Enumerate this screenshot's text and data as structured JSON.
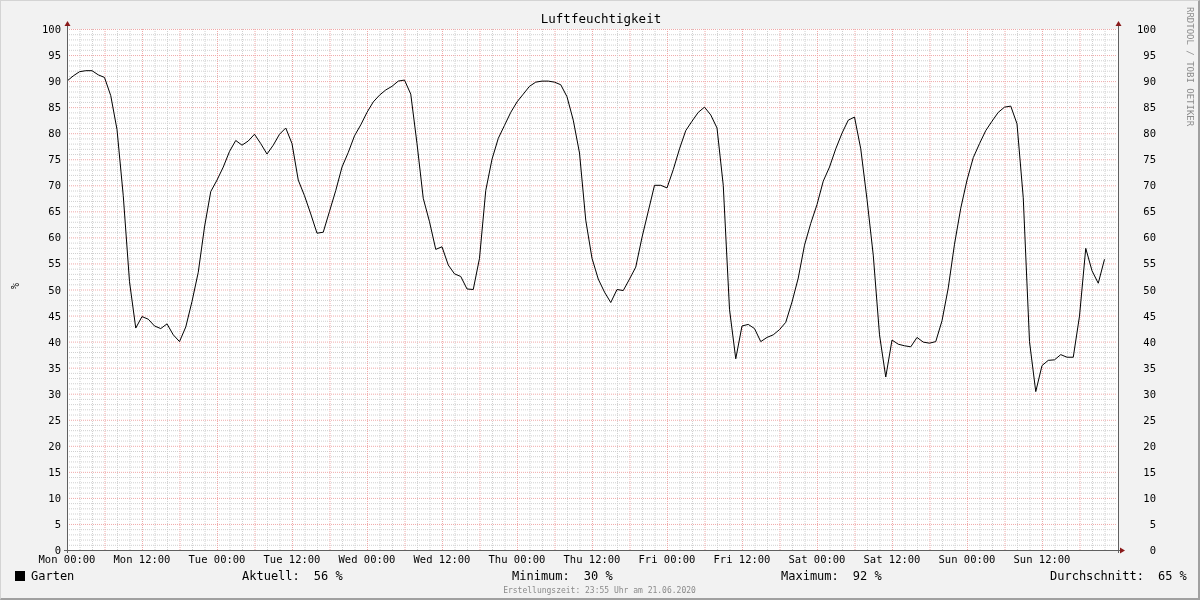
{
  "graph": {
    "left_axis_unit": "%",
    "brand": "RRDTOOL / TOBI OETIKER",
    "right_axis_labels": [
      "100",
      "95",
      "90",
      "85",
      "80",
      "75",
      "70",
      "65",
      "60",
      "55",
      "50",
      "45",
      "40",
      "35",
      "30",
      "25",
      "20",
      "15",
      "10",
      "5",
      "0"
    ],
    "chart_data": {
      "type": "line",
      "title": "Luftfeuchtigkeit",
      "ylim": [
        0,
        100
      ],
      "grid": true,
      "yticks": [
        0,
        5,
        10,
        15,
        20,
        25,
        30,
        35,
        40,
        45,
        50,
        55,
        60,
        65,
        70,
        75,
        80,
        85,
        90,
        95,
        100
      ],
      "categories": [
        "Mon 00:00",
        null,
        null,
        null,
        null,
        null,
        null,
        null,
        null,
        null,
        null,
        null,
        "Mon 12:00",
        null,
        null,
        null,
        null,
        null,
        null,
        null,
        null,
        null,
        null,
        null,
        "Tue 00:00",
        null,
        null,
        null,
        null,
        null,
        null,
        null,
        null,
        null,
        null,
        null,
        "Tue 12:00",
        null,
        null,
        null,
        null,
        null,
        null,
        null,
        null,
        null,
        null,
        null,
        "Wed 00:00",
        null,
        null,
        null,
        null,
        null,
        null,
        null,
        null,
        null,
        null,
        null,
        "Wed 12:00",
        null,
        null,
        null,
        null,
        null,
        null,
        null,
        null,
        null,
        null,
        null,
        "Thu 00:00",
        null,
        null,
        null,
        null,
        null,
        null,
        null,
        null,
        null,
        null,
        null,
        "Thu 12:00",
        null,
        null,
        null,
        null,
        null,
        null,
        null,
        null,
        null,
        null,
        null,
        "Fri 00:00",
        null,
        null,
        null,
        null,
        null,
        null,
        null,
        null,
        null,
        null,
        null,
        "Fri 12:00",
        null,
        null,
        null,
        null,
        null,
        null,
        null,
        null,
        null,
        null,
        null,
        "Sat 00:00",
        null,
        null,
        null,
        null,
        null,
        null,
        null,
        null,
        null,
        null,
        null,
        "Sat 12:00",
        null,
        null,
        null,
        null,
        null,
        null,
        null,
        null,
        null,
        null,
        null,
        "Sun 00:00",
        null,
        null,
        null,
        null,
        null,
        null,
        null,
        null,
        null,
        null,
        null,
        "Sun 12:00",
        null,
        null,
        null,
        null,
        null,
        null,
        null,
        null,
        null,
        null
      ],
      "series": [
        {
          "name": "Garten",
          "color": "#000000",
          "values": [
            90,
            91,
            91.8,
            92,
            92,
            91.2,
            90.7,
            87.2,
            80.7,
            68,
            51.5,
            42.6,
            44.8,
            44.3,
            43,
            42.5,
            43.4,
            41.3,
            40,
            42.8,
            47.7,
            53.3,
            62,
            68.8,
            71,
            73.5,
            76.5,
            78.6,
            77.7,
            78.5,
            79.8,
            78,
            76,
            77.7,
            79.8,
            81,
            78,
            71,
            68,
            64.5,
            60.8,
            61,
            65,
            69,
            73.5,
            76.3,
            79.5,
            81.6,
            84,
            86,
            87.3,
            88.3,
            89,
            90,
            90.2,
            87.5,
            78,
            67.5,
            63,
            57.7,
            58.2,
            54.7,
            53,
            52.5,
            50.1,
            50,
            56,
            69,
            75,
            79,
            81.5,
            84,
            86,
            87.5,
            89,
            89.8,
            90,
            90,
            89.8,
            89.3,
            87,
            82.5,
            76.2,
            63.3,
            56,
            52,
            49.5,
            47.5,
            50,
            49.8,
            52,
            54.3,
            60,
            65,
            70,
            70,
            69.5,
            73,
            77,
            80.5,
            82.3,
            84,
            85,
            83.5,
            81,
            70,
            46.2,
            36.7,
            43,
            43.3,
            42.5,
            40,
            40.8,
            41.3,
            42.3,
            43.7,
            47.6,
            52.2,
            58.5,
            62.7,
            66.3,
            70.8,
            73.5,
            77,
            80,
            82.5,
            83.1,
            77,
            67.3,
            56.6,
            41.3,
            33.2,
            40.3,
            39.5,
            39.2,
            39,
            40.8,
            39.9,
            39.7,
            40,
            44,
            50.3,
            58.7,
            65.6,
            71,
            75.3,
            78,
            80.5,
            82.3,
            84,
            85,
            85.2,
            81.8,
            67.6,
            40,
            30.4,
            35.4,
            36.4,
            36.5,
            37.5,
            37,
            37,
            44.9,
            57.9,
            53.6,
            51.2,
            55.8
          ]
        }
      ]
    }
  },
  "legend": {
    "stats": [
      {
        "label": "Aktuell:",
        "value": "56 %"
      },
      {
        "label": "Minimum:",
        "value": "30 %"
      },
      {
        "label": "Maximum:",
        "value": "92 %"
      },
      {
        "label": "Durchschnitt:",
        "value": "65 %"
      }
    ]
  },
  "footer": "Erstellungszeit: 23:55 Uhr am 21.06.2020"
}
